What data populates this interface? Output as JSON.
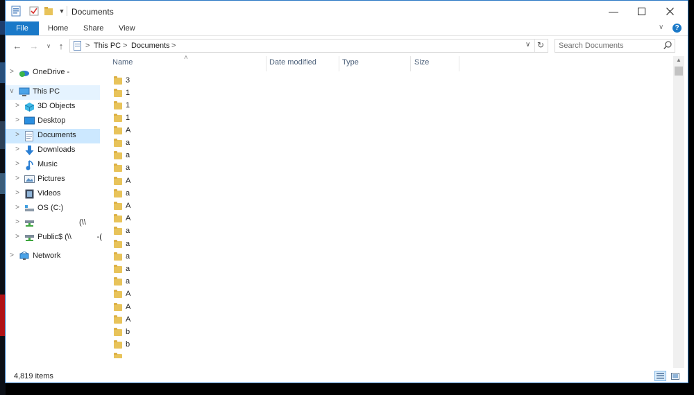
{
  "window": {
    "title": "Documents"
  },
  "ribbon": {
    "tabs": [
      "File",
      "Home",
      "Share",
      "View"
    ]
  },
  "address": {
    "crumbs": [
      "This PC",
      "Documents"
    ],
    "separator": ">"
  },
  "search": {
    "placeholder": "Search Documents"
  },
  "nav": {
    "items": [
      {
        "label": "OneDrive -",
        "icon": "onedrive-icon",
        "chevron": ">",
        "indent": 0
      },
      {
        "label": "This PC",
        "icon": "computer-icon",
        "chevron": "v",
        "indent": 0
      },
      {
        "label": "3D Objects",
        "icon": "cube-icon",
        "chevron": ">",
        "indent": 1
      },
      {
        "label": "Desktop",
        "icon": "desktop-icon",
        "chevron": ">",
        "indent": 1
      },
      {
        "label": "Documents",
        "icon": "document-icon",
        "chevron": ">",
        "indent": 1
      },
      {
        "label": "Downloads",
        "icon": "download-icon",
        "chevron": ">",
        "indent": 1
      },
      {
        "label": "Music",
        "icon": "music-icon",
        "chevron": ">",
        "indent": 1
      },
      {
        "label": "Pictures",
        "icon": "pictures-icon",
        "chevron": ">",
        "indent": 1
      },
      {
        "label": "Videos",
        "icon": "videos-icon",
        "chevron": ">",
        "indent": 1
      },
      {
        "label": "OS (C:)",
        "icon": "drive-icon",
        "chevron": ">",
        "indent": 1
      },
      {
        "label": "(\\\\",
        "icon": "network-drive-icon",
        "chevron": ">",
        "indent": 1
      },
      {
        "label": "Public$ (\\\\            -(",
        "icon": "network-drive-icon",
        "chevron": ">",
        "indent": 1
      },
      {
        "label": "Network",
        "icon": "network-icon",
        "chevron": ">",
        "indent": 0
      }
    ]
  },
  "list": {
    "columns": [
      "Name",
      "Date modified",
      "Type",
      "Size"
    ],
    "files": [
      "3",
      "1",
      "1",
      "1",
      "A",
      "a",
      "a",
      "a",
      "A",
      "a",
      "A",
      "A",
      "a",
      "a",
      "a",
      "a",
      "a",
      "A",
      "A",
      "A",
      "b",
      "b"
    ]
  },
  "status": {
    "item_count": "4,819 items"
  }
}
